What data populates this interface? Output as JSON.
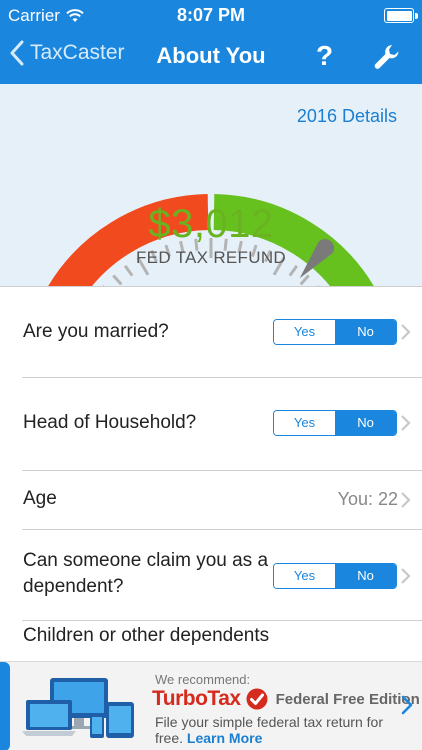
{
  "status_bar": {
    "carrier": "Carrier",
    "time": "8:07 PM",
    "battery_level": 1.0
  },
  "nav": {
    "back_label": "TaxCaster",
    "title": "About You",
    "help_label": "?",
    "tools_icon": "wrench-icon"
  },
  "gauge": {
    "details_link": "2016 Details",
    "amount": "$3,012",
    "label": "FED TAX REFUND",
    "colors": {
      "negative": "#f24a1f",
      "positive": "#66c11e",
      "needle": "#7a7a7a"
    }
  },
  "questions": {
    "married": {
      "label": "Are you married?",
      "yes": "Yes",
      "no": "No",
      "selected": "No"
    },
    "head_of_household": {
      "label": "Head of Household?",
      "yes": "Yes",
      "no": "No",
      "selected": "No"
    },
    "age": {
      "label": "Age",
      "value": "You: 22"
    },
    "dependent": {
      "label": "Can someone claim you as a dependent?",
      "yes": "Yes",
      "no": "No",
      "selected": "No"
    },
    "children": {
      "label": "Children or other dependents"
    }
  },
  "ad": {
    "recommend": "We recommend:",
    "brand": "TurboTax",
    "edition": "Federal Free Edition",
    "copy": "File your simple federal tax return for free.",
    "learn_more": "Learn More"
  },
  "theme": {
    "accent": "#1a86dd"
  }
}
